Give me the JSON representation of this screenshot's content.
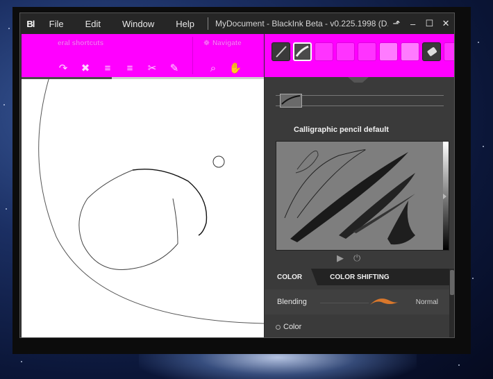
{
  "app": {
    "logo": "Bl",
    "title": "MyDocument - BlackInk Beta - v0.225.1998 (D..."
  },
  "menu": {
    "items": [
      {
        "label": "File"
      },
      {
        "label": "Edit"
      },
      {
        "label": "Window"
      },
      {
        "label": "Help"
      }
    ]
  },
  "window_controls": {
    "restore_down": "⬏",
    "minimize": "–",
    "maximize": "☐",
    "close": "✕"
  },
  "toolbar": {
    "section1_label": "eral shortcuts",
    "section2_label": "Navigate",
    "icons": [
      {
        "icon": "redo-icon",
        "glyph": "↷"
      },
      {
        "icon": "delete-icon",
        "glyph": "✖"
      },
      {
        "icon": "layer-up-icon",
        "glyph": "≡"
      },
      {
        "icon": "layer-down-icon",
        "glyph": "≡"
      },
      {
        "icon": "scissors-icon",
        "glyph": "✂"
      },
      {
        "icon": "eraser-icon",
        "glyph": "✎"
      }
    ],
    "nav_icons": [
      {
        "icon": "zoom-icon",
        "glyph": "⌕"
      },
      {
        "icon": "hand-icon",
        "glyph": "✋"
      }
    ]
  },
  "brush_panel": {
    "preset_name": "Calligraphic pencil default"
  },
  "tabs": [
    {
      "label": "COLOR"
    },
    {
      "label": "COLOR SHIFTING"
    }
  ],
  "blending": {
    "label": "Blending",
    "value": "Normal"
  },
  "color": {
    "label": "Color"
  },
  "colors": {
    "toolbar": "#ff00ff",
    "panel": "#3a3a3a",
    "accent_stroke": "#d9772b"
  }
}
